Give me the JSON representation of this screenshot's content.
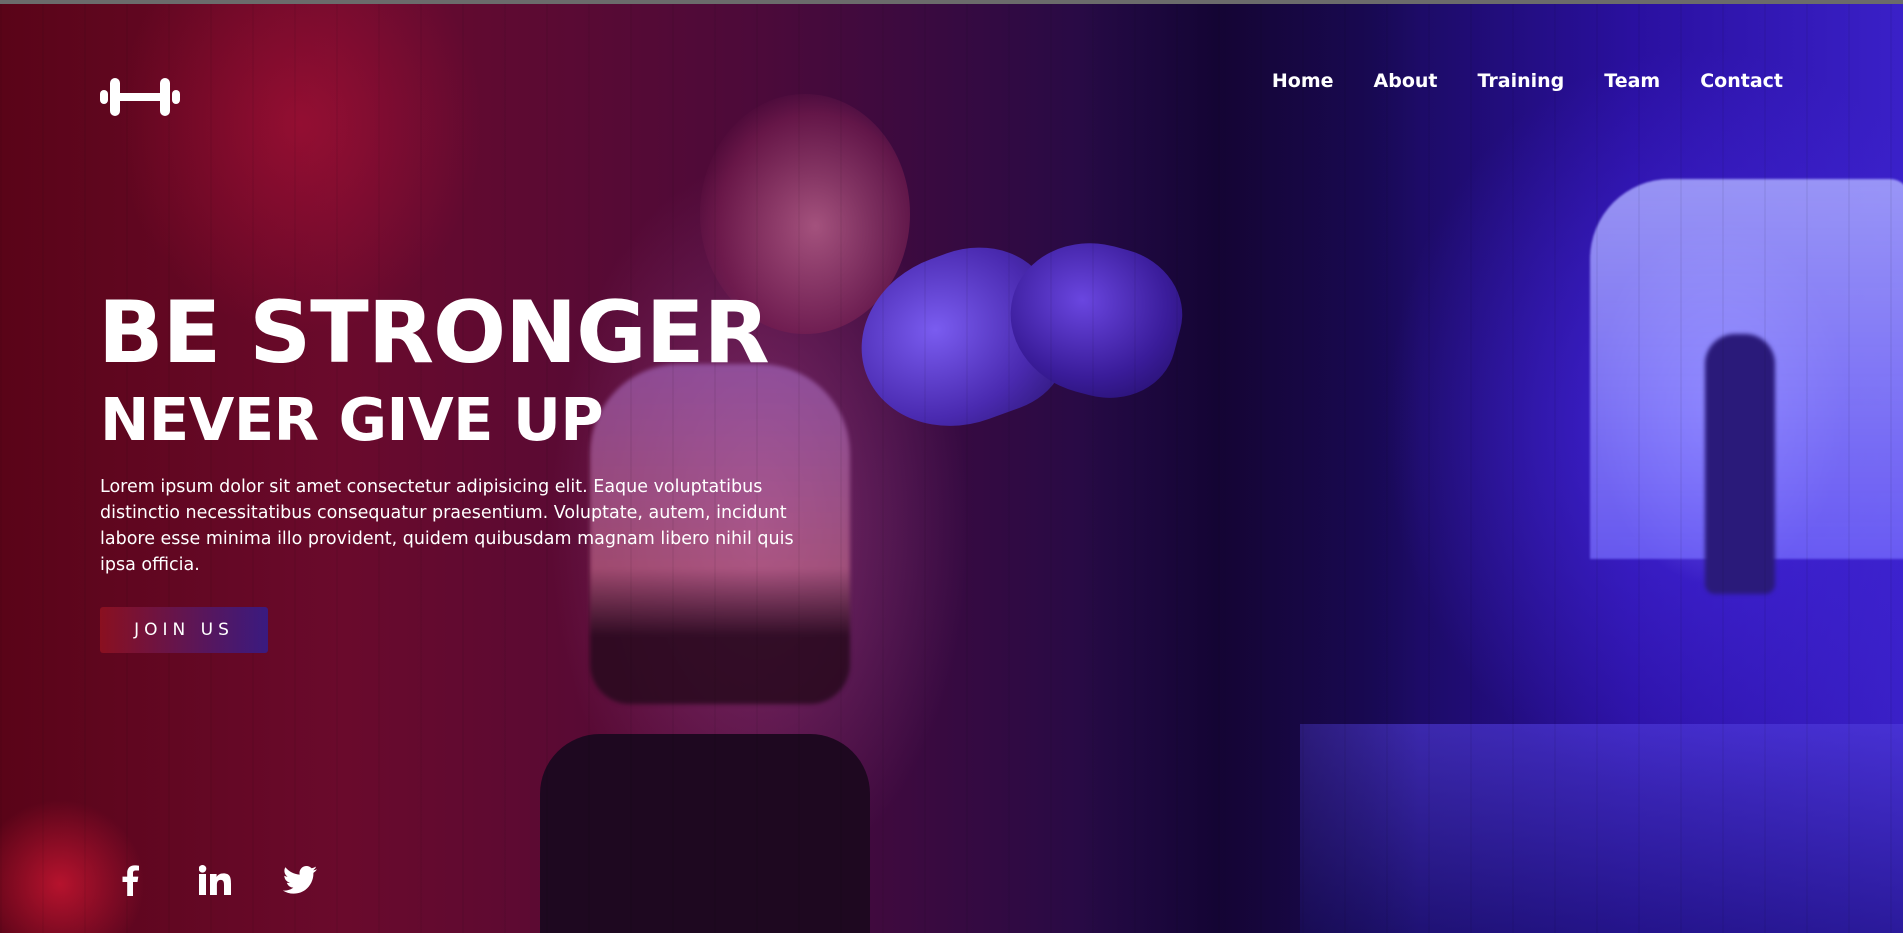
{
  "nav": {
    "items": [
      {
        "label": "Home"
      },
      {
        "label": "About"
      },
      {
        "label": "Training"
      },
      {
        "label": "Team"
      },
      {
        "label": "Contact"
      }
    ]
  },
  "logo": {
    "icon": "dumbbell-icon"
  },
  "hero": {
    "headline": "BE STRONGER",
    "subheadline": "NEVER GIVE UP",
    "description": "Lorem ipsum dolor sit amet consectetur adipisicing elit. Eaque voluptatibus distinctio necessitatibus consequatur praesentium. Voluptate, autem, incidunt labore esse minima illo provident, quidem quibusdam magnam libero nihil quis ipsa officia.",
    "cta_label": "JOIN US"
  },
  "social": {
    "items": [
      {
        "icon": "facebook-icon"
      },
      {
        "icon": "linkedin-icon"
      },
      {
        "icon": "twitter-icon"
      }
    ]
  },
  "colors": {
    "text": "#ffffff",
    "cta_start": "#8a1020",
    "cta_end": "#3a1a80",
    "bg_left": "#5a0418",
    "bg_right": "#3a20c8"
  }
}
